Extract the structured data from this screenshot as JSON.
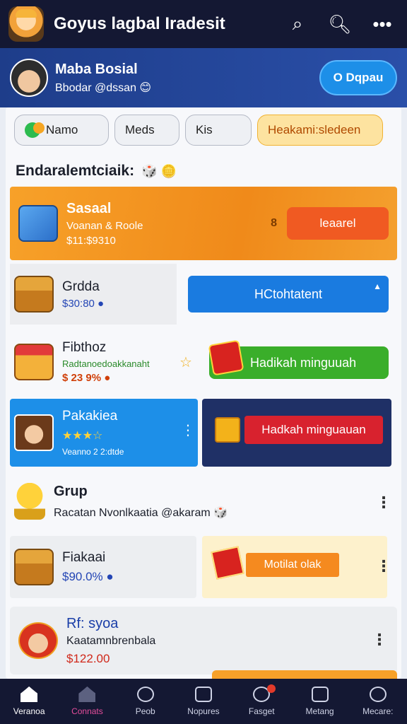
{
  "topbar": {
    "title": "Goyus lagbal Iradesit",
    "icons": [
      "app-logo",
      "search-icon",
      "search-icon",
      "more-icon"
    ]
  },
  "profile": {
    "name": "Maba Bosial",
    "handle": "Bbodar @dssan 😊",
    "button": "O Dqpau"
  },
  "chips": [
    "Namo",
    "Meds",
    "Kis",
    "Heakami:sledeen"
  ],
  "section": {
    "title": "Endaralemtciaik:",
    "emoji": "🎲 🪙"
  },
  "items": {
    "r1": {
      "title": "Sasaal",
      "sub": "Voanan & Roole",
      "price": "$11:$​9310",
      "coin": "8",
      "action": "leaarel"
    },
    "r2": {
      "title": "Grdda",
      "price": "$30:8​0 ●",
      "button": "HCtohtatent"
    },
    "r3": {
      "title": "Fibthoz",
      "sub": "Radtanoedoakkanaht",
      "price": "$ 23 9% ●",
      "button": "Hadikah minguuah"
    },
    "r4": {
      "title": "Pakakiea",
      "stars": "★★★☆",
      "sub": "Veanno 2 2:dtde",
      "button": "Hadkah minguauan"
    },
    "r5": {
      "title": "Grup",
      "sub": "Racatan Nvonlkaatia @akaram 🎲"
    },
    "r6": {
      "title": "Fiakaai",
      "price": "$90.0% ●",
      "button": "Motilat olak"
    },
    "r7": {
      "title": "Rf: syoa",
      "sub": "Kaatamnbrenbala",
      "price": "$122.00"
    }
  },
  "nav": [
    {
      "label": "Veranoa",
      "icon": "home-icon"
    },
    {
      "label": "Connats",
      "icon": "home-icon"
    },
    {
      "label": "Peob",
      "icon": "smile-icon"
    },
    {
      "label": "Nopures",
      "icon": "box-icon"
    },
    {
      "label": "Fasget",
      "icon": "game-icon"
    },
    {
      "label": "Metang",
      "icon": "controller-icon"
    },
    {
      "label": "Mecare:",
      "icon": "user-icon"
    }
  ]
}
